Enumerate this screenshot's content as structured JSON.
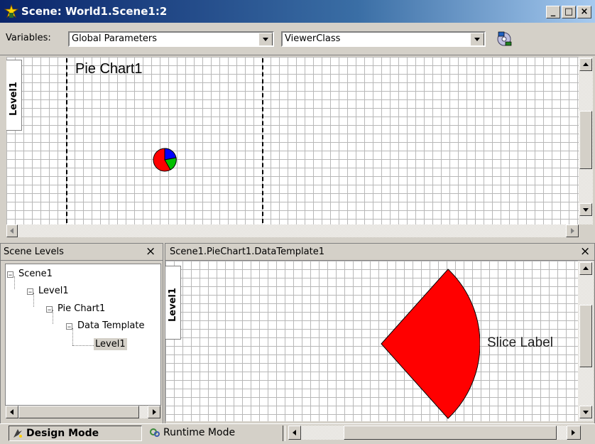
{
  "window": {
    "title": "Scene: World1.Scene1:2",
    "controls": {
      "minimize": "_",
      "maximize": "□",
      "close": "×"
    }
  },
  "toolbar": {
    "variables_label": "Variables:",
    "variables_value": "Global Parameters",
    "class_value": "ViewerClass",
    "action_icon": "network-cd-icon"
  },
  "top_canvas": {
    "level_tab": "Level1",
    "object_label": "Pie Chart1"
  },
  "scene_levels": {
    "title": "Scene Levels",
    "close": "×",
    "tree": [
      {
        "label": "Scene1",
        "expander": "−"
      },
      {
        "label": "Level1",
        "expander": "−"
      },
      {
        "label": "Pie Chart1",
        "expander": "−"
      },
      {
        "label": "Data Template",
        "expander": "−"
      },
      {
        "label": "Level1",
        "selected": true
      }
    ]
  },
  "template_panel": {
    "title": "Scene1.PieChart1.DataTemplate1",
    "close": "×",
    "level_tab": "Level1",
    "slice_label": "Slice Label"
  },
  "status_tabs": {
    "design": "Design Mode",
    "runtime": "Runtime Mode"
  },
  "colors": {
    "slice": "#ff0000",
    "pie_blue": "#0000ff",
    "pie_green": "#00c000",
    "title_bar": "#0a246a"
  }
}
